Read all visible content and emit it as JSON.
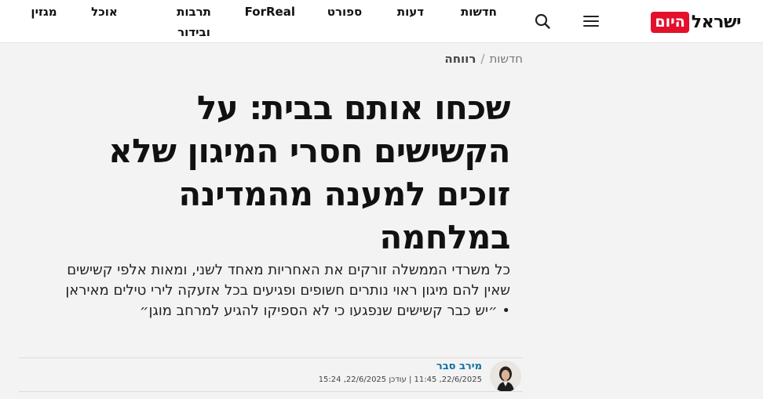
{
  "header": {
    "logo_text": "ישראל",
    "logo_box_text": "היום",
    "nav": [
      {
        "label": "חדשות"
      },
      {
        "label": "דעות"
      },
      {
        "label": "ספורט"
      },
      {
        "label": "ForReal"
      },
      {
        "label": "תרבות\nובידור"
      },
      {
        "label": "אוכל"
      },
      {
        "label": "מגזין"
      }
    ],
    "icons": {
      "menu": "hamburger-menu-icon",
      "search": "search-icon"
    }
  },
  "breadcrumb": {
    "items": [
      "חדשות",
      "רווחה"
    ],
    "separator": "/"
  },
  "article": {
    "title": "שכחו אותם בבית: על הקשישים חסרי המיגון שלא זוכים למענה מהמדינה במלחמה",
    "subtitle": "כל משרדי הממשלה זורקים את האחריות מאחד לשני, ומאות אלפי קשישים שאין להם מיגון ראוי נותרים חשופים ופגיעים בכל אזעקה לירי טילים מאיראן • ״יש כבר קשישים שנפגעו כי לא הספיקו להגיע למרחב מוגן״",
    "author": "מירב סבר",
    "dates": "22/6/2025, 11:45 | עודכן 22/6/2025, 15:24"
  },
  "colors": {
    "brand_red": "#e4102b",
    "author_link": "#0b6fa4",
    "page_bg": "#f3f3f3"
  }
}
